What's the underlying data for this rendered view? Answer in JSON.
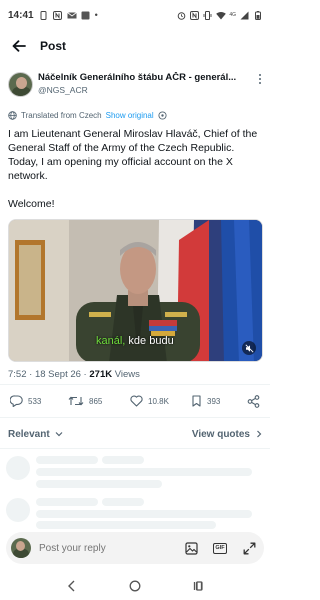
{
  "status_bar": {
    "time": "14:41",
    "network": "4G"
  },
  "header": {
    "title": "Post"
  },
  "author": {
    "name": "Náčelník Generálního štábu AČR - generál...",
    "handle": "@NGS_ACR"
  },
  "translation": {
    "label": "Translated from Czech",
    "show_original": "Show original"
  },
  "tweet": {
    "paragraph1": "I am Lieutenant General Miroslav Hlaváč, Chief of the General Staff of the Army of the Czech Republic. Today, I am opening my official account on the X network.",
    "paragraph2": "Welcome!"
  },
  "media": {
    "caption_word1": "kanál,",
    "caption_word2": "kde budu"
  },
  "meta": {
    "time": "7:52",
    "date": "18 Sept 26",
    "views_count": "271K",
    "views_label": "Views"
  },
  "actions": {
    "replies": "533",
    "reposts": "865",
    "likes": "10.8K",
    "bookmarks": "393"
  },
  "filters": {
    "sort_label": "Relevant",
    "view_quotes": "View quotes"
  },
  "reply": {
    "placeholder": "Post your reply"
  },
  "colors": {
    "accent": "#1d9bf0",
    "caption_highlight": "#6fdc3c",
    "secondary_text": "#536471"
  },
  "icons": [
    "back-arrow-icon",
    "more-icon",
    "translate-icon",
    "info-icon",
    "mute-icon",
    "reply-icon",
    "repost-icon",
    "like-icon",
    "bookmark-icon",
    "share-icon",
    "chevron-down-icon",
    "chevron-right-icon",
    "image-icon",
    "gif-icon",
    "expand-icon",
    "nav-back-icon",
    "nav-home-icon",
    "nav-recents-icon"
  ]
}
